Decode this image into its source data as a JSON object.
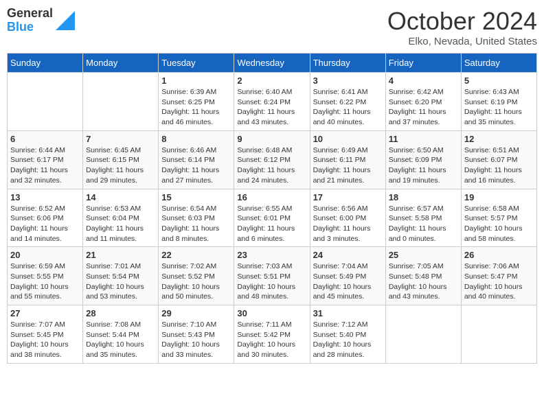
{
  "header": {
    "logo_general": "General",
    "logo_blue": "Blue",
    "month_title": "October 2024",
    "location": "Elko, Nevada, United States"
  },
  "calendar": {
    "days_of_week": [
      "Sunday",
      "Monday",
      "Tuesday",
      "Wednesday",
      "Thursday",
      "Friday",
      "Saturday"
    ],
    "weeks": [
      [
        {
          "day": "",
          "info": ""
        },
        {
          "day": "",
          "info": ""
        },
        {
          "day": "1",
          "info": "Sunrise: 6:39 AM\nSunset: 6:25 PM\nDaylight: 11 hours and 46 minutes."
        },
        {
          "day": "2",
          "info": "Sunrise: 6:40 AM\nSunset: 6:24 PM\nDaylight: 11 hours and 43 minutes."
        },
        {
          "day": "3",
          "info": "Sunrise: 6:41 AM\nSunset: 6:22 PM\nDaylight: 11 hours and 40 minutes."
        },
        {
          "day": "4",
          "info": "Sunrise: 6:42 AM\nSunset: 6:20 PM\nDaylight: 11 hours and 37 minutes."
        },
        {
          "day": "5",
          "info": "Sunrise: 6:43 AM\nSunset: 6:19 PM\nDaylight: 11 hours and 35 minutes."
        }
      ],
      [
        {
          "day": "6",
          "info": "Sunrise: 6:44 AM\nSunset: 6:17 PM\nDaylight: 11 hours and 32 minutes."
        },
        {
          "day": "7",
          "info": "Sunrise: 6:45 AM\nSunset: 6:15 PM\nDaylight: 11 hours and 29 minutes."
        },
        {
          "day": "8",
          "info": "Sunrise: 6:46 AM\nSunset: 6:14 PM\nDaylight: 11 hours and 27 minutes."
        },
        {
          "day": "9",
          "info": "Sunrise: 6:48 AM\nSunset: 6:12 PM\nDaylight: 11 hours and 24 minutes."
        },
        {
          "day": "10",
          "info": "Sunrise: 6:49 AM\nSunset: 6:11 PM\nDaylight: 11 hours and 21 minutes."
        },
        {
          "day": "11",
          "info": "Sunrise: 6:50 AM\nSunset: 6:09 PM\nDaylight: 11 hours and 19 minutes."
        },
        {
          "day": "12",
          "info": "Sunrise: 6:51 AM\nSunset: 6:07 PM\nDaylight: 11 hours and 16 minutes."
        }
      ],
      [
        {
          "day": "13",
          "info": "Sunrise: 6:52 AM\nSunset: 6:06 PM\nDaylight: 11 hours and 14 minutes."
        },
        {
          "day": "14",
          "info": "Sunrise: 6:53 AM\nSunset: 6:04 PM\nDaylight: 11 hours and 11 minutes."
        },
        {
          "day": "15",
          "info": "Sunrise: 6:54 AM\nSunset: 6:03 PM\nDaylight: 11 hours and 8 minutes."
        },
        {
          "day": "16",
          "info": "Sunrise: 6:55 AM\nSunset: 6:01 PM\nDaylight: 11 hours and 6 minutes."
        },
        {
          "day": "17",
          "info": "Sunrise: 6:56 AM\nSunset: 6:00 PM\nDaylight: 11 hours and 3 minutes."
        },
        {
          "day": "18",
          "info": "Sunrise: 6:57 AM\nSunset: 5:58 PM\nDaylight: 11 hours and 0 minutes."
        },
        {
          "day": "19",
          "info": "Sunrise: 6:58 AM\nSunset: 5:57 PM\nDaylight: 10 hours and 58 minutes."
        }
      ],
      [
        {
          "day": "20",
          "info": "Sunrise: 6:59 AM\nSunset: 5:55 PM\nDaylight: 10 hours and 55 minutes."
        },
        {
          "day": "21",
          "info": "Sunrise: 7:01 AM\nSunset: 5:54 PM\nDaylight: 10 hours and 53 minutes."
        },
        {
          "day": "22",
          "info": "Sunrise: 7:02 AM\nSunset: 5:52 PM\nDaylight: 10 hours and 50 minutes."
        },
        {
          "day": "23",
          "info": "Sunrise: 7:03 AM\nSunset: 5:51 PM\nDaylight: 10 hours and 48 minutes."
        },
        {
          "day": "24",
          "info": "Sunrise: 7:04 AM\nSunset: 5:49 PM\nDaylight: 10 hours and 45 minutes."
        },
        {
          "day": "25",
          "info": "Sunrise: 7:05 AM\nSunset: 5:48 PM\nDaylight: 10 hours and 43 minutes."
        },
        {
          "day": "26",
          "info": "Sunrise: 7:06 AM\nSunset: 5:47 PM\nDaylight: 10 hours and 40 minutes."
        }
      ],
      [
        {
          "day": "27",
          "info": "Sunrise: 7:07 AM\nSunset: 5:45 PM\nDaylight: 10 hours and 38 minutes."
        },
        {
          "day": "28",
          "info": "Sunrise: 7:08 AM\nSunset: 5:44 PM\nDaylight: 10 hours and 35 minutes."
        },
        {
          "day": "29",
          "info": "Sunrise: 7:10 AM\nSunset: 5:43 PM\nDaylight: 10 hours and 33 minutes."
        },
        {
          "day": "30",
          "info": "Sunrise: 7:11 AM\nSunset: 5:42 PM\nDaylight: 10 hours and 30 minutes."
        },
        {
          "day": "31",
          "info": "Sunrise: 7:12 AM\nSunset: 5:40 PM\nDaylight: 10 hours and 28 minutes."
        },
        {
          "day": "",
          "info": ""
        },
        {
          "day": "",
          "info": ""
        }
      ]
    ]
  }
}
